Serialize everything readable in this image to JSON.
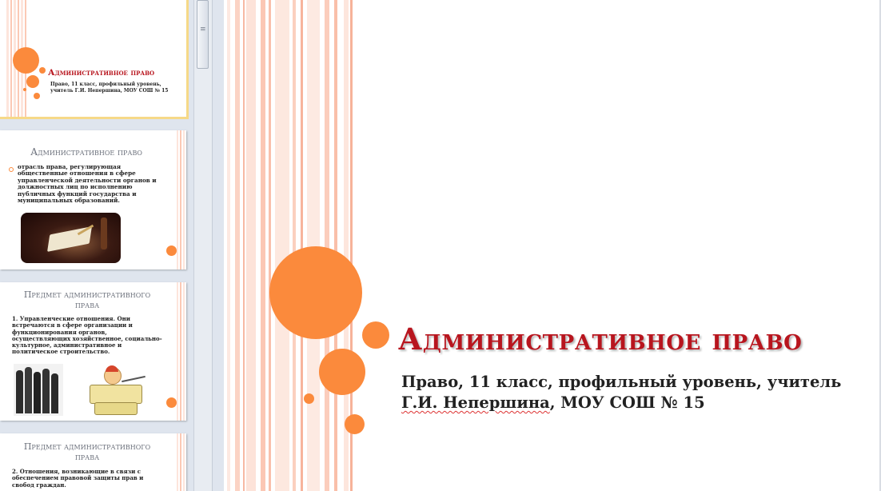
{
  "thumbnails": [
    {
      "title": "Административное право",
      "subtitle": "Право, 11 класс, профильный уровень, учитель Г.И. Непершина, МОУ СОШ № 15"
    },
    {
      "title": "Административное право",
      "body": "отрасль права, регулирующая общественные отношения в сфере управленческой деятельности органов и должностных лиц по исполнению публичных функций государства и муниципальных образований.",
      "image_label": "book-and-gavel-image"
    },
    {
      "title": "Предмет административного права",
      "body": "1. Управленческие отношения. Они встречаются в сфере организации и функционирования органов, осуществляющих хозяйственное, социально-культурное, административное и политическое строительство."
    },
    {
      "title": "Предмет административного права",
      "body": "2. Отношения, возникающие в связи с обеспечением правовой защиты прав и свобод граждан."
    }
  ],
  "slide": {
    "title": "Административное право",
    "subtitle_line1": "Право, 11 класс, профильный уровень, учитель",
    "subtitle_line2_name": "Г.И. Непершина",
    "subtitle_line2_rest": ", МОУ СОШ № 15"
  },
  "colors": {
    "accent_orange": "#fb8a3c",
    "title_red": "#b8151e",
    "stripe_pink": "#fbd3c4"
  },
  "icons": {
    "scroll_grip": "≡"
  }
}
